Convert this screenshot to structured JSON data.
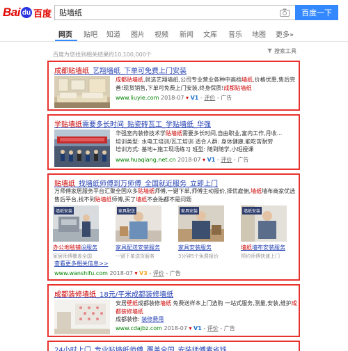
{
  "header": {
    "logo_bai": "Bai",
    "logo_du": "du",
    "logo_paw": "du",
    "logo_cn": "百度",
    "query": "贴墙纸",
    "search_button": "百度一下"
  },
  "tabs": [
    {
      "label": "网页",
      "active": true
    },
    {
      "label": "贴吧"
    },
    {
      "label": "知道"
    },
    {
      "label": "图片"
    },
    {
      "label": "视频"
    },
    {
      "label": "新闻"
    },
    {
      "label": "文库"
    },
    {
      "label": "音乐"
    },
    {
      "label": "地图"
    },
    {
      "label": "更多»"
    }
  ],
  "info": {
    "count_text": "百度为您找到相关结果约10,100,000个",
    "tools": "搜索工具"
  },
  "results": [
    {
      "title_hl1": "成都贴墙纸",
      "title_rest": "_艺翔墙纸_下单可免费上门安装",
      "desc": [
        {
          "t": "成都贴墙纸",
          "hl": true
        },
        {
          "t": ",就选艺翔墙纸,公司专业营业各种中高档"
        },
        {
          "t": "墙纸",
          "hl": true
        },
        {
          "t": ",价格优惠,售后完善!现货销售,下单可免费上门安装,终身保质!"
        },
        {
          "t": "成都贴墙纸",
          "hl": true
        }
      ],
      "url": "www.liuyie.com",
      "date": "2018-07",
      "v": "V1",
      "eval": "评价",
      "ad": "广告"
    },
    {
      "title_hl1": "学贴墙纸",
      "title_rest": "需要多长时间_贴瓷砖瓦工_学贴墙纸_华强",
      "desc_lines": [
        [
          {
            "t": "华强室内装修技术学"
          },
          {
            "t": "贴墙纸",
            "hl": true
          },
          {
            "t": "需要多长时间,自由职业,富内工作,月收..."
          }
        ],
        [
          {
            "t": "培训类型:  水电工培训/瓦工培训      适合人群:  身体健康,能吃苦耐劳"
          }
        ],
        [
          {
            "t": "培训方式:  基地+施工现场练习        班型:  随到随学,小班授课"
          }
        ]
      ],
      "url": "www.huaqiang.net.cn",
      "date": "2018-07",
      "v": "V1",
      "eval": "评价",
      "ad": "广告"
    },
    {
      "title_hl1": "贴墙纸",
      "title_rest": "_找墙纸师傅到万师傅_全国就近服务_立即上门",
      "desc": [
        {
          "t": "万师傅家居服务平台汇聚全国众多"
        },
        {
          "t": "贴墙纸",
          "hl": true
        },
        {
          "t": "师傅,一键下单,师傅主动报价,择优雇佣,"
        },
        {
          "t": "墙纸",
          "hl": true
        },
        {
          "t": "墙布商家优选售后平台,找不到"
        },
        {
          "t": "贴墙纸",
          "hl": true
        },
        {
          "t": "师傅,买了"
        },
        {
          "t": "墙纸",
          "hl": true
        },
        {
          "t": "不会贴都不是问题"
        }
      ],
      "subs": [
        {
          "tag": "墙纸安装",
          "title_hl": "办公地毯铺",
          "title_rest": "设服务",
          "desc": "家居师傅覆盖全国"
        },
        {
          "tag": "家具配送",
          "title_hl": "",
          "title_rest": "家具配送安装服务",
          "desc": "一键下单送货服务"
        },
        {
          "tag": "家具安装",
          "title_hl": "",
          "title_rest": "家具安装服务",
          "desc": "3分钟5个免费报价"
        },
        {
          "tag": "墙纸安装",
          "title_hl": "墙纸",
          "title_rest": "墙布安装服务",
          "desc": "预约师傅快速上门"
        }
      ],
      "more": "查看更多相关信息>>",
      "url": "www.wanshifu.com",
      "date": "2018-07",
      "v": "V3",
      "eval": "评价",
      "ad": "广告"
    },
    {
      "title_hl1": "成都装修墙纸",
      "title_rest": "_18元/平米成都装修墙纸",
      "desc": [
        {
          "t": "安居"
        },
        {
          "t": "壁纸",
          "hl": true
        },
        {
          "t": "成都装修"
        },
        {
          "t": "墙纸",
          "hl": true
        },
        {
          "t": " 免费送样本上门选购 一站式服务,测量,安装,维护"
        },
        {
          "t": "成都装修墙纸",
          "hl": true
        }
      ],
      "sub_link": "装修费用",
      "sub_prefix": "成都装修:",
      "url": "www.cdajbz.com",
      "date": "2018-07",
      "v": "V1",
      "eval": "评价",
      "ad": "广告"
    },
    {
      "title_rest": "24小时上门_专业贴墙纸师傅_覆盖全国_安装师傅素省钱"
    }
  ],
  "colors": {
    "brand_red": "#e10601",
    "brand_blue": "#2932e1",
    "button_blue": "#3388ff",
    "link_blue": "#2440b3",
    "highlight_red": "#cc0000",
    "url_green": "#008000",
    "box_red": "#e8322e"
  }
}
